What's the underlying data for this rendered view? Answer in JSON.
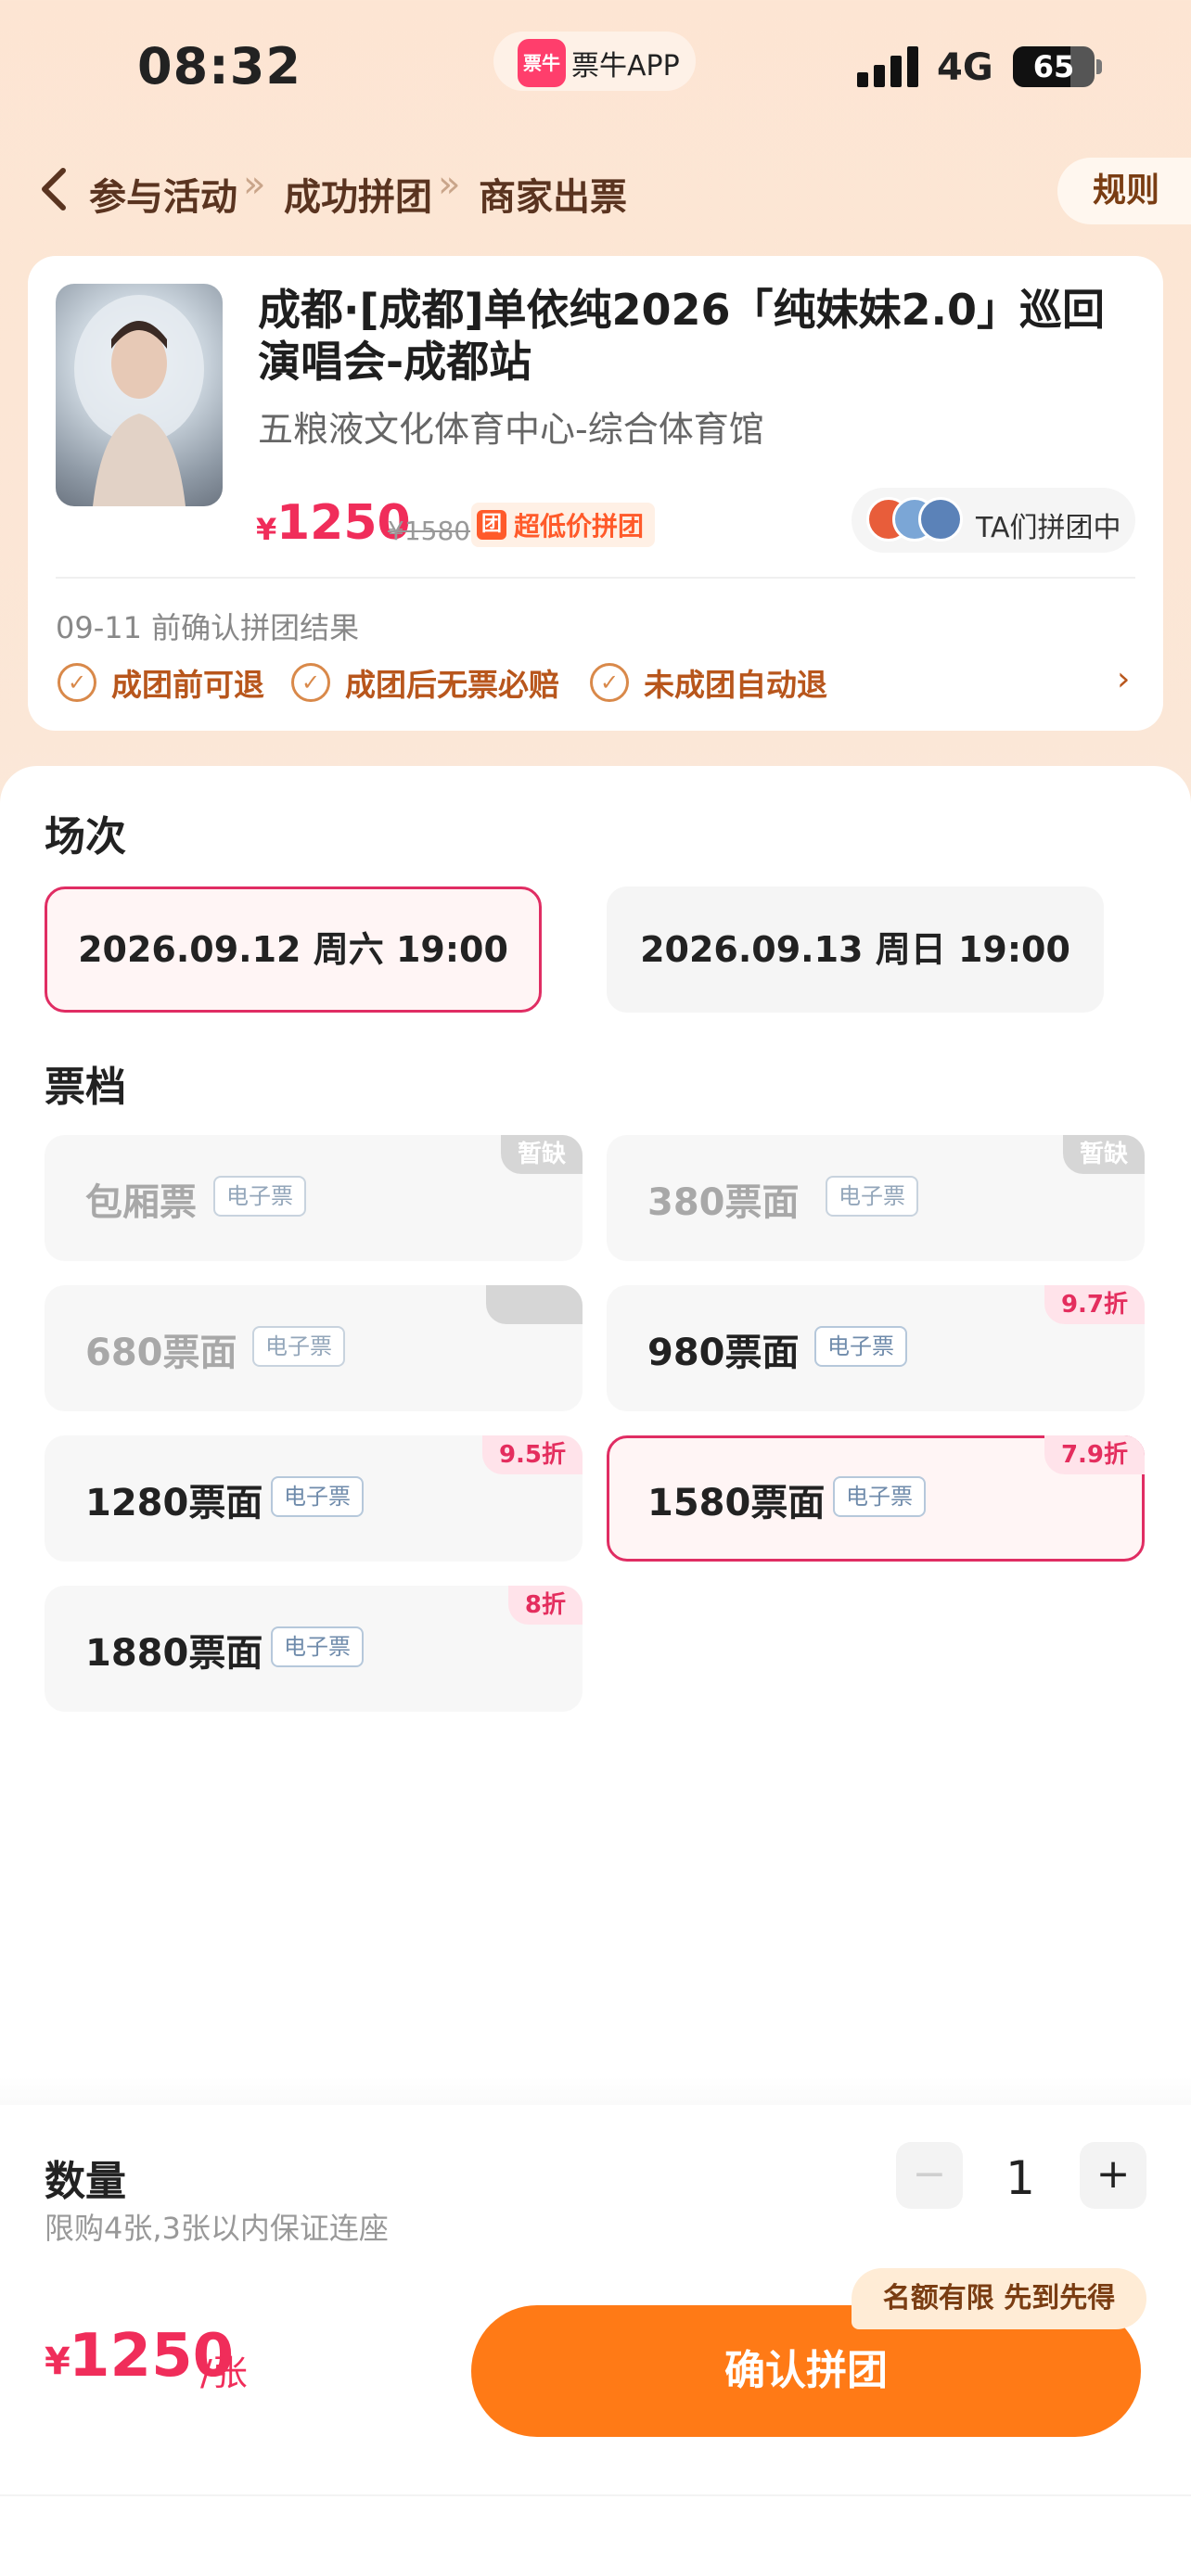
{
  "status_bar": {
    "time": "08:32",
    "app_name": "票牛APP",
    "app_logo_text": "票牛",
    "network": "4G",
    "battery": "65"
  },
  "breadcrumb": {
    "items": [
      "参与活动",
      "成功拼团",
      "商家出票"
    ],
    "separator": "»",
    "rules_label": "规则"
  },
  "event": {
    "title": "成都·[成都]单依纯2026「纯妹妹2.0」巡回演唱会-成都站",
    "venue": "五粮液文化体育中心-综合体育馆",
    "currency": "¥",
    "price": "1250",
    "original_price": "¥1580",
    "tag_icon": "团",
    "tag_label": "超低价拼团",
    "group_status": "TA们拼团中",
    "deadline": "09-11 前确认拼团结果",
    "guarantees": [
      "成团前可退",
      "成团后无票必赔",
      "未成团自动退"
    ]
  },
  "sessions": {
    "title": "场次",
    "options": [
      "2026.09.12 周六 19:00",
      "2026.09.13 周日 19:00"
    ],
    "selected_index": 0
  },
  "tiers": {
    "title": "票档",
    "items": [
      {
        "name": "包厢票",
        "type": "电子票",
        "badge": "暂缺",
        "available": false
      },
      {
        "name": "380票面",
        "type": "电子票",
        "badge": "暂缺",
        "available": false
      },
      {
        "name": "680票面",
        "type": "电子票",
        "badge": "",
        "available": false
      },
      {
        "name": "980票面",
        "type": "电子票",
        "badge": "9.7折",
        "available": true
      },
      {
        "name": "1280票面",
        "type": "电子票",
        "badge": "9.5折",
        "available": true
      },
      {
        "name": "1580票面",
        "type": "电子票",
        "badge": "7.9折",
        "available": true,
        "selected": true
      },
      {
        "name": "1880票面",
        "type": "电子票",
        "badge": "8折",
        "available": true
      }
    ]
  },
  "quantity": {
    "title": "数量",
    "note": "限购4张,3张以内保证连座",
    "value": "1",
    "minus": "−",
    "plus": "+"
  },
  "footer": {
    "currency": "¥",
    "price": "1250",
    "unit": "/张",
    "confirm_label": "确认拼团",
    "limit_badge": "名额有限 先到先得"
  },
  "colors": {
    "accent": "#ff7a16",
    "price": "#f02d5a",
    "selected_border": "#e02d63",
    "background": "#fde5d3"
  }
}
